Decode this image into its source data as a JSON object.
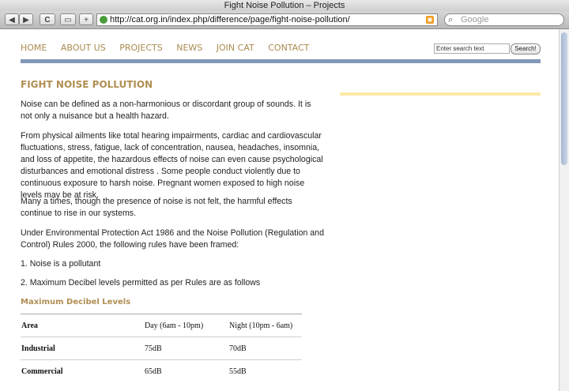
{
  "window": {
    "title": "Fight Noise Pollution – Projects"
  },
  "browser": {
    "url": "http://cat.org.in/index.php/difference/page/fight-noise-pollution/",
    "search_placeholder": "Google",
    "buttons": {
      "back": "◀",
      "forward": "▶",
      "reload": "C",
      "add": "+"
    }
  },
  "site": {
    "nav": [
      "HOME",
      "ABOUT US",
      "PROJECTS",
      "NEWS",
      "JOIN CAT",
      "CONTACT"
    ],
    "search_value": "Enter search text",
    "search_button": "Search!",
    "accent_color": "#b08e52",
    "rule_color": "#8297b7"
  },
  "page": {
    "title": "FIGHT NOISE POLLUTION",
    "paragraphs": [
      "Noise can be defined as a non-harmonious or discordant group of sounds. It is not only a nuisance but a health hazard.",
      "From physical ailments like total hearing impairments, cardiac and cardiovascular fluctuations, stress, fatigue, lack of concentration, nausea, headaches, insomnia, and loss of appetite, the hazardous effects of noise can even cause psychological disturbances and emotional distress . Some people conduct violently due to continuous exposure to harsh noise. Pregnant women exposed to high noise levels may be at risk.",
      "Many a times, though the presence of noise is not felt, the harmful effects continue to rise in our systems.",
      "Under Environmental Protection Act 1986 and the Noise Pollution (Regulation and Control) Rules 2000, the following rules have been framed:",
      "1.  Noise is a pollutant",
      "2.  Maximum Decibel levels permitted as per Rules are as follows"
    ],
    "subheading": "Maximum Decibel Levels",
    "table": [
      [
        "Area",
        "Day (6am - 10pm)",
        "Night (10pm - 6am)"
      ],
      [
        "Industrial",
        "75dB",
        "70dB"
      ],
      [
        "Commercial",
        "65dB",
        "55dB"
      ]
    ]
  }
}
